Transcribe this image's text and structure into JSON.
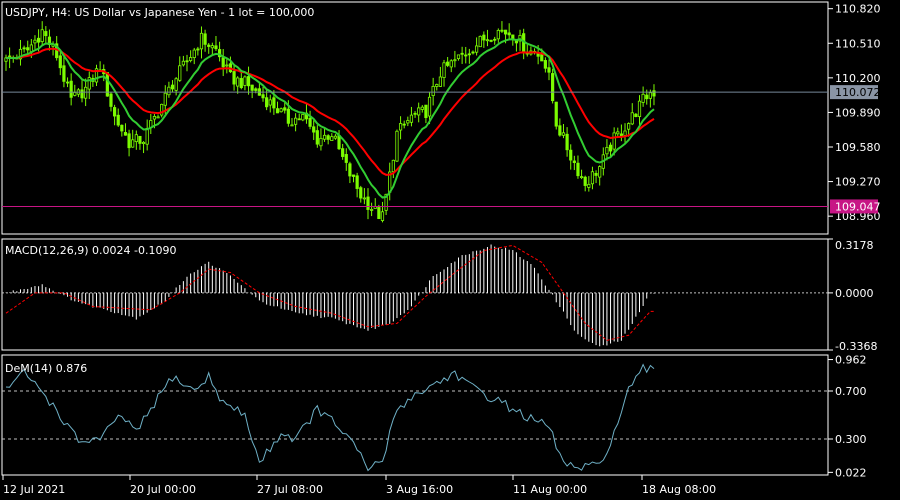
{
  "header": {
    "symbol_line": "USDJPY, H4:  US Dollar vs Japanese Yen - 1 lot = 100,000",
    "macd_label": "MACD(12,26,9) 0.0024 -0.1090",
    "dem_label": "DeM(14) 0.876"
  },
  "colors": {
    "background": "#000000",
    "frame": "#ffffff",
    "candle": "#7CFC00",
    "ma_fast": "#32cd32",
    "ma_slow": "#ff0000",
    "macd_hist": "#ffffff",
    "macd_signal": "#ff0000",
    "dem_line": "#6fb1c7",
    "grid": "#c0c0c0",
    "bid_line": "#778899",
    "bid_label_bg": "#8a95a5",
    "hline": "#c71585",
    "hline_label_bg": "#c71585"
  },
  "chart_data": [
    {
      "type": "candlestick",
      "panel": "price",
      "title": "USDJPY, H4:  US Dollar vs Japanese Yen - 1 lot = 100,000",
      "ylim": [
        108.8,
        110.88
      ],
      "y_ticks": [
        "110.820",
        "110.510",
        "110.200",
        "109.890",
        "109.580",
        "109.270",
        "108.960"
      ],
      "current_price": "110.072",
      "horizontal_line": "109.047",
      "close_anchors": [
        [
          0,
          110.35
        ],
        [
          6,
          110.45
        ],
        [
          10,
          110.62
        ],
        [
          14,
          110.4
        ],
        [
          18,
          110.0
        ],
        [
          22,
          110.1
        ],
        [
          26,
          110.3
        ],
        [
          30,
          109.85
        ],
        [
          34,
          109.62
        ],
        [
          38,
          109.65
        ],
        [
          42,
          109.9
        ],
        [
          46,
          110.15
        ],
        [
          50,
          110.35
        ],
        [
          54,
          110.55
        ],
        [
          58,
          110.45
        ],
        [
          62,
          110.2
        ],
        [
          66,
          110.15
        ],
        [
          70,
          110.05
        ],
        [
          74,
          109.95
        ],
        [
          78,
          109.82
        ],
        [
          82,
          109.85
        ],
        [
          86,
          109.65
        ],
        [
          90,
          109.7
        ],
        [
          94,
          109.4
        ],
        [
          98,
          109.15
        ],
        [
          102,
          109.0
        ],
        [
          104,
          108.95
        ],
        [
          108,
          109.7
        ],
        [
          112,
          109.85
        ],
        [
          116,
          109.9
        ],
        [
          120,
          110.25
        ],
        [
          124,
          110.35
        ],
        [
          128,
          110.45
        ],
        [
          132,
          110.55
        ],
        [
          136,
          110.62
        ],
        [
          140,
          110.6
        ],
        [
          144,
          110.45
        ],
        [
          148,
          110.4
        ],
        [
          150,
          110.2
        ],
        [
          152,
          109.8
        ],
        [
          156,
          109.5
        ],
        [
          160,
          109.25
        ],
        [
          164,
          109.4
        ],
        [
          168,
          109.65
        ],
        [
          172,
          109.8
        ],
        [
          176,
          110.0
        ],
        [
          178,
          110.07
        ]
      ]
    },
    {
      "type": "bar",
      "panel": "macd",
      "title": "MACD(12,26,9) 0.0024 -0.1090",
      "ylim": [
        -0.3368,
        0.3178
      ],
      "y_ticks": [
        "0.3178",
        "0.0000",
        "-0.3368"
      ],
      "macd_anchors": [
        [
          0,
          0.0
        ],
        [
          6,
          0.03
        ],
        [
          10,
          0.05
        ],
        [
          16,
          -0.02
        ],
        [
          22,
          -0.07
        ],
        [
          28,
          -0.1
        ],
        [
          36,
          -0.15
        ],
        [
          44,
          -0.05
        ],
        [
          50,
          0.1
        ],
        [
          56,
          0.18
        ],
        [
          62,
          0.1
        ],
        [
          70,
          -0.05
        ],
        [
          80,
          -0.12
        ],
        [
          90,
          -0.15
        ],
        [
          100,
          -0.22
        ],
        [
          106,
          -0.18
        ],
        [
          112,
          -0.08
        ],
        [
          118,
          0.1
        ],
        [
          126,
          0.22
        ],
        [
          134,
          0.28
        ],
        [
          140,
          0.25
        ],
        [
          146,
          0.15
        ],
        [
          152,
          -0.05
        ],
        [
          158,
          -0.25
        ],
        [
          164,
          -0.32
        ],
        [
          170,
          -0.28
        ],
        [
          176,
          -0.08
        ],
        [
          178,
          0.0024
        ]
      ],
      "signal_anchors": [
        [
          0,
          -0.12
        ],
        [
          8,
          0.0
        ],
        [
          16,
          0.0
        ],
        [
          24,
          -0.08
        ],
        [
          32,
          -0.09
        ],
        [
          40,
          -0.1
        ],
        [
          48,
          0.0
        ],
        [
          56,
          0.14
        ],
        [
          62,
          0.12
        ],
        [
          70,
          0.0
        ],
        [
          80,
          -0.08
        ],
        [
          90,
          -0.12
        ],
        [
          100,
          -0.2
        ],
        [
          108,
          -0.18
        ],
        [
          116,
          -0.02
        ],
        [
          124,
          0.12
        ],
        [
          132,
          0.25
        ],
        [
          140,
          0.28
        ],
        [
          148,
          0.18
        ],
        [
          154,
          0.0
        ],
        [
          160,
          -0.18
        ],
        [
          166,
          -0.28
        ],
        [
          172,
          -0.25
        ],
        [
          178,
          -0.109
        ]
      ]
    },
    {
      "type": "line",
      "panel": "demarker",
      "title": "DeM(14) 0.876",
      "ylim": [
        0.0,
        1.0
      ],
      "y_ticks": [
        "0.962",
        "0.700",
        "0.300",
        "0.022"
      ],
      "dashed_levels": [
        0.7,
        0.3
      ],
      "dem_anchors": [
        [
          0,
          0.72
        ],
        [
          5,
          0.85
        ],
        [
          10,
          0.7
        ],
        [
          16,
          0.45
        ],
        [
          20,
          0.28
        ],
        [
          26,
          0.3
        ],
        [
          32,
          0.5
        ],
        [
          36,
          0.35
        ],
        [
          40,
          0.55
        ],
        [
          46,
          0.82
        ],
        [
          52,
          0.7
        ],
        [
          56,
          0.82
        ],
        [
          60,
          0.6
        ],
        [
          66,
          0.5
        ],
        [
          70,
          0.1
        ],
        [
          76,
          0.35
        ],
        [
          80,
          0.3
        ],
        [
          86,
          0.55
        ],
        [
          92,
          0.4
        ],
        [
          96,
          0.25
        ],
        [
          100,
          0.05
        ],
        [
          104,
          0.12
        ],
        [
          108,
          0.55
        ],
        [
          112,
          0.65
        ],
        [
          118,
          0.75
        ],
        [
          124,
          0.85
        ],
        [
          130,
          0.7
        ],
        [
          136,
          0.62
        ],
        [
          140,
          0.55
        ],
        [
          146,
          0.45
        ],
        [
          150,
          0.4
        ],
        [
          154,
          0.1
        ],
        [
          158,
          0.05
        ],
        [
          164,
          0.08
        ],
        [
          168,
          0.35
        ],
        [
          172,
          0.7
        ],
        [
          176,
          0.88
        ],
        [
          178,
          0.876
        ]
      ]
    }
  ],
  "x_axis": {
    "labels": [
      "12 Jul 2021",
      "20 Jul 00:00",
      "27 Jul 08:00",
      "3 Aug 16:00",
      "11 Aug 00:00",
      "18 Aug 08:00"
    ]
  }
}
